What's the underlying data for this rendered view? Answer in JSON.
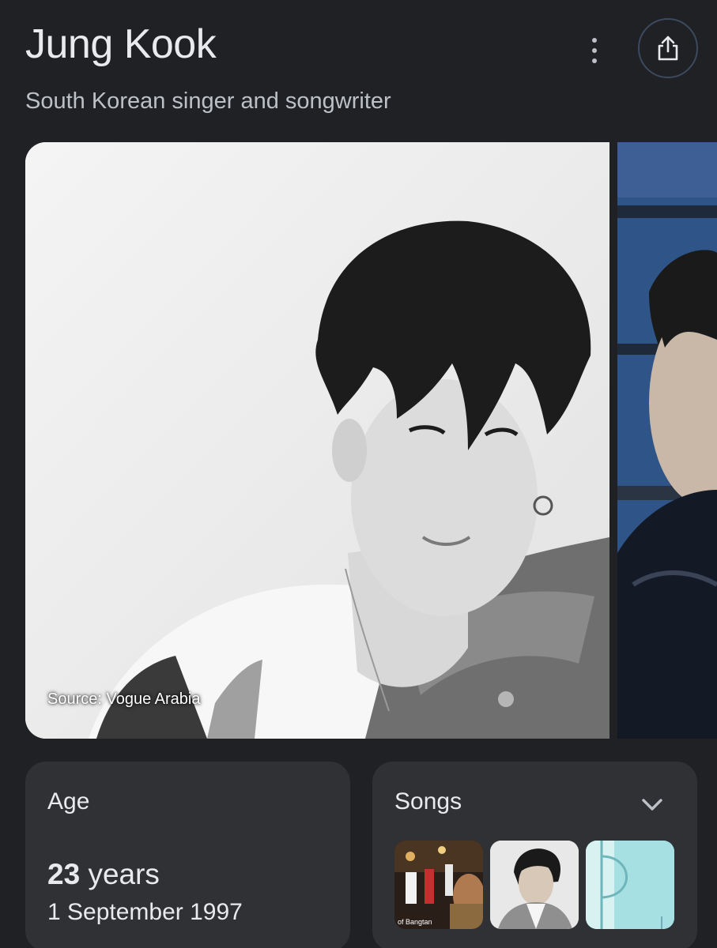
{
  "header": {
    "title": "Jung Kook",
    "subtitle": "South Korean singer and songwriter"
  },
  "icons": {
    "more": "more-vert-icon",
    "share": "share-icon",
    "expand": "chevron-down-icon"
  },
  "images": {
    "hero_source": "Source: Vogue Arabia"
  },
  "age_card": {
    "label": "Age",
    "value": "23",
    "unit": "years",
    "birth_date": "1 September 1997"
  },
  "songs_card": {
    "label": "Songs",
    "thumbnails": [
      {
        "caption": "of Bangtan"
      },
      {
        "caption": ""
      },
      {
        "caption": ""
      }
    ]
  },
  "colors": {
    "background": "#202124",
    "card": "#303134",
    "text_primary": "#e8eaed",
    "text_secondary": "#bdc1c6",
    "share_border": "#3c4a5e"
  }
}
